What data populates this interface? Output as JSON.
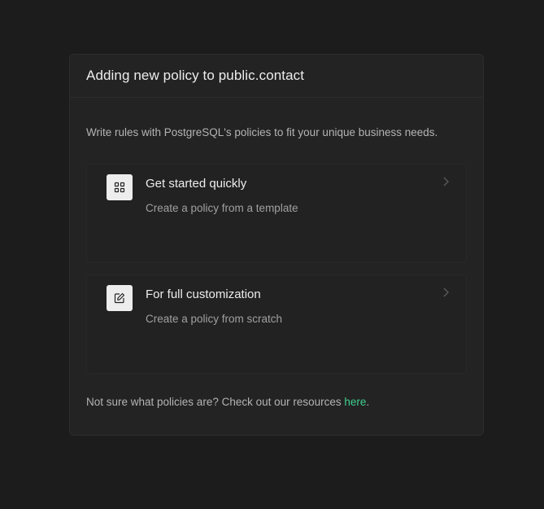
{
  "dialog": {
    "title": "Adding new policy to public.contact",
    "intro": "Write rules with PostgreSQL's policies to fit your unique business needs."
  },
  "options": [
    {
      "title": "Get started quickly",
      "description": "Create a policy from a template",
      "icon": "grid-icon"
    },
    {
      "title": "For full customization",
      "description": "Create a policy from scratch",
      "icon": "edit-icon"
    }
  ],
  "footer": {
    "text": "Not sure what policies are? Check out our resources ",
    "link_label": "here",
    "suffix": "."
  },
  "colors": {
    "background": "#1c1c1c",
    "panel": "#232323",
    "accent_link": "#3ecf8e",
    "text_primary": "#ededed",
    "text_secondary": "#a0a0a0"
  }
}
